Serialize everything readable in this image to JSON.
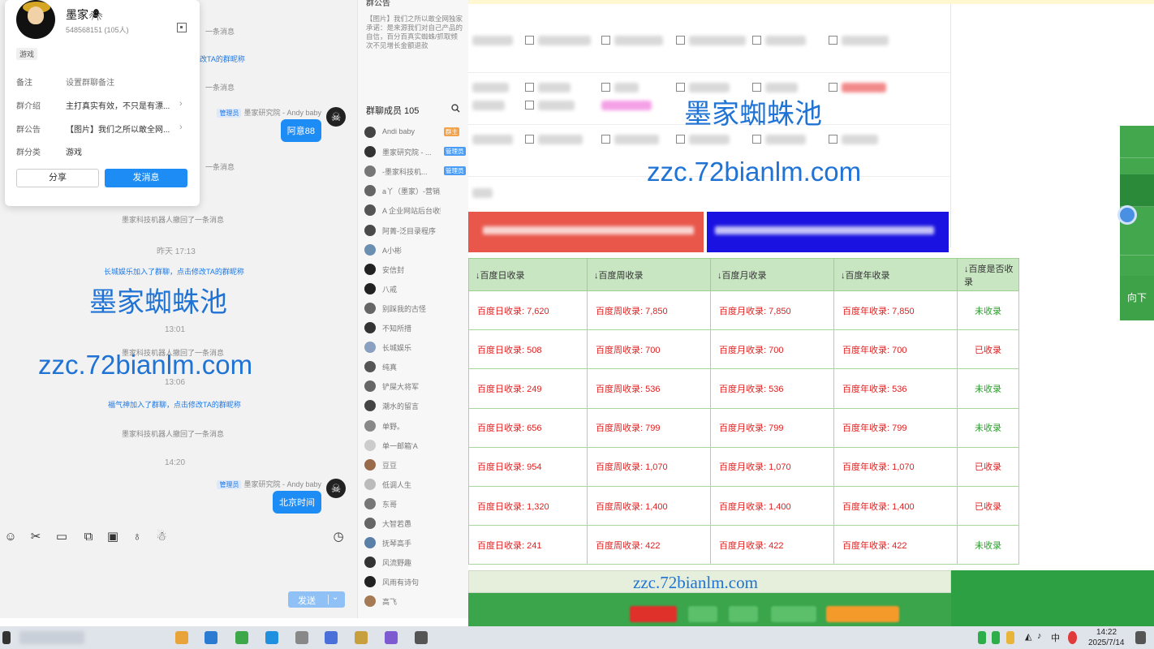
{
  "webpage": {
    "watermark_cn": "墨家蜘蛛池",
    "watermark_url": "zzc.72bianlm.com",
    "table": {
      "headers": [
        "↓百度日收录",
        "↓百度周收录",
        "↓百度月收录",
        "↓百度年收录",
        "↓百度是否收录"
      ],
      "rows": [
        [
          "百度日收录: 7,620",
          "百度周收录: 7,850",
          "百度月收录: 7,850",
          "百度年收录: 7,850",
          "未收录"
        ],
        [
          "百度日收录: 508",
          "百度周收录: 700",
          "百度月收录: 700",
          "百度年收录: 700",
          "已收录"
        ],
        [
          "百度日收录: 249",
          "百度周收录: 536",
          "百度月收录: 536",
          "百度年收录: 536",
          "未收录"
        ],
        [
          "百度日收录: 656",
          "百度周收录: 799",
          "百度月收录: 799",
          "百度年收录: 799",
          "未收录"
        ],
        [
          "百度日收录: 954",
          "百度周收录: 1,070",
          "百度月收录: 1,070",
          "百度年收录: 1,070",
          "已收录"
        ],
        [
          "百度日收录: 1,320",
          "百度周收录: 1,400",
          "百度月收录: 1,400",
          "百度年收录: 1,400",
          "已收录"
        ],
        [
          "百度日收录: 241",
          "百度周收录: 422",
          "百度月收录: 422",
          "百度年收录: 422",
          "未收录"
        ]
      ]
    },
    "bottom_url": "zzc.72bianlm.com",
    "side_down_label": "向下",
    "colors": {
      "table_header_bg": "#c8e6c1",
      "table_border": "#a8d79e",
      "value_red": "#e02020",
      "status_green": "#2e9d2e",
      "watermark_blue": "#1f73d4",
      "promo_red": "#e9574b",
      "promo_blue": "#1a12e0",
      "footer_green": "#3aa54a"
    }
  },
  "group_card": {
    "name": "墨家🕷",
    "id_line": "548568151 (105人)",
    "tag": "游戏",
    "rows": [
      {
        "key": "备注",
        "value": "设置群聊备注"
      },
      {
        "key": "群介绍",
        "value": "主打真实有效，不只是有漂..."
      },
      {
        "key": "群公告",
        "value": "【图片】我们之所以敢全网..."
      },
      {
        "key": "群分类",
        "value": "游戏"
      }
    ],
    "share_label": "分享",
    "send_msg_label": "发消息"
  },
  "chat": {
    "sys_top_1": "一条消息",
    "sys_top_2": "改TA的群昵称",
    "sys_top_3": "一条消息",
    "msg1_sender": "墨家研究院 - Andy baby",
    "admin_badge": "管理员",
    "msg1_text": "阿意88",
    "sys_mid_1": "一条消息",
    "sys_recall_1": "墨家科技机器人撤回了一条消息",
    "time_1": "昨天 17:13",
    "join_1_name": "长城娱乐加入了群聊，",
    "join_1_link": "点击修改TA的群昵称",
    "time_2": "13:01",
    "sys_recall_2": "墨家科技机器人撤回了一条消息",
    "time_3": "13:06",
    "join_2_name": "福气神加入了群聊，",
    "join_2_link": "点击修改TA的群昵称",
    "sys_recall_3": "墨家科技机器人撤回了一条消息",
    "time_4": "14:20",
    "msg2_sender": "墨家研究院 - Andy baby",
    "msg2_text": "北京时间",
    "send_label": "发送"
  },
  "member_panel": {
    "notice_title": "群公告",
    "notice_body": "【图片】我们之所以敢全网独家承诺：是来源我们对自己产品的自信，百分百真实蜘蛛/抓取频次不见增长金额退款",
    "members_title": "群聊成员 105",
    "owner_badge": "群主",
    "admin_badge": "管理员",
    "members": [
      {
        "name": "Andi baby",
        "role": "owner"
      },
      {
        "name": "墨家研究院 - ...",
        "role": "admin"
      },
      {
        "name": "-墨家科技机...",
        "role": "admin"
      },
      {
        "name": "a丫（墨家）-营销鬼才",
        "role": ""
      },
      {
        "name": "A 企业网站后台收购",
        "role": ""
      },
      {
        "name": "阿菁-泛目录程序",
        "role": ""
      },
      {
        "name": "A小彬",
        "role": ""
      },
      {
        "name": "安信封",
        "role": ""
      },
      {
        "name": "八戒",
        "role": ""
      },
      {
        "name": "别踩我的古怪",
        "role": ""
      },
      {
        "name": "不知所措",
        "role": ""
      },
      {
        "name": "长城娱乐",
        "role": ""
      },
      {
        "name": "纯真",
        "role": ""
      },
      {
        "name": "铲屎大将军",
        "role": ""
      },
      {
        "name": "潮水的留言",
        "role": ""
      },
      {
        "name": "单野。",
        "role": ""
      },
      {
        "name": "单一邮箱'A",
        "role": ""
      },
      {
        "name": "豆豆",
        "role": ""
      },
      {
        "name": "低调人生",
        "role": ""
      },
      {
        "name": "东哥",
        "role": ""
      },
      {
        "name": "大智若愚",
        "role": ""
      },
      {
        "name": "抚琴高手",
        "role": ""
      },
      {
        "name": "风流野趣",
        "role": ""
      },
      {
        "name": "风雨有诗句",
        "role": ""
      },
      {
        "name": "高飞",
        "role": ""
      }
    ]
  },
  "taskbar": {
    "tray_lang": "中",
    "clock_time": "14:22",
    "clock_date": "2025/7/14"
  }
}
